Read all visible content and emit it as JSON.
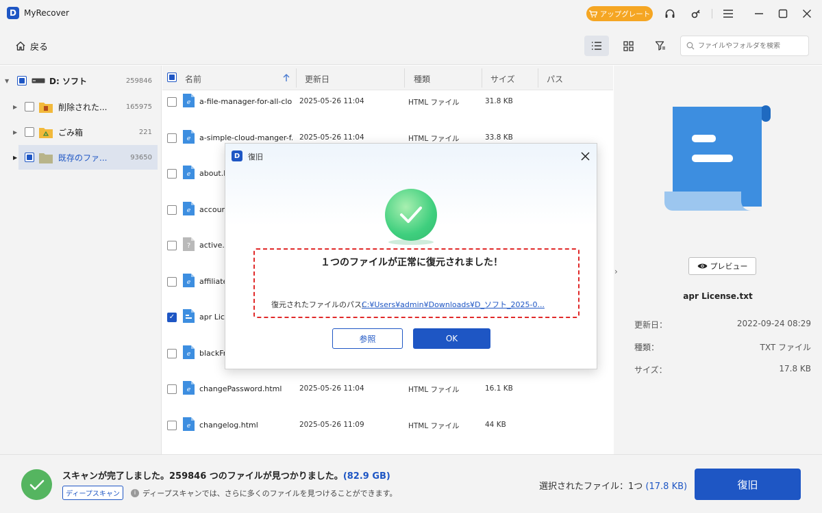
{
  "app": {
    "title": "MyRecover",
    "logo_letter": "D"
  },
  "titlebar": {
    "upgrade_label": "アップグレート"
  },
  "toolbar": {
    "back_label": "戻る",
    "search_placeholder": "ファイルやフォルダを検索"
  },
  "sidebar": {
    "items": [
      {
        "label": "D: ソフト",
        "count": "259846",
        "state": "partial"
      },
      {
        "label": "削除された...",
        "count": "165975",
        "state": "unchecked"
      },
      {
        "label": "ごみ箱",
        "count": "221",
        "state": "unchecked"
      },
      {
        "label": "既存のファ...",
        "count": "93650",
        "state": "partial",
        "selected": true
      }
    ]
  },
  "list": {
    "columns": [
      "名前",
      "更新日",
      "種類",
      "サイズ",
      "パス"
    ],
    "rows": [
      {
        "name": "a-file-manager-for-all-clo...",
        "date": "2025-05-26 11:04",
        "type": "HTML ファイル",
        "size": "31.8 KB",
        "icon": "html-file-icon"
      },
      {
        "name": "a-simple-cloud-manger-f...",
        "date": "2025-05-26 11:04",
        "type": "HTML ファイル",
        "size": "33.8 KB",
        "icon": "html-file-icon"
      },
      {
        "name": "about.h",
        "date": "",
        "type": "",
        "size": "",
        "icon": "html-file-icon"
      },
      {
        "name": "accoun",
        "date": "",
        "type": "",
        "size": "",
        "icon": "html-file-icon"
      },
      {
        "name": "active.h",
        "date": "",
        "type": "",
        "size": "",
        "icon": "unknown-file-icon"
      },
      {
        "name": "affiliate",
        "date": "",
        "type": "",
        "size": "",
        "icon": "html-file-icon"
      },
      {
        "name": "apr Lice",
        "date": "",
        "type": "",
        "size": "",
        "icon": "txt-file-icon",
        "checked": true
      },
      {
        "name": "blackFri",
        "date": "",
        "type": "",
        "size": "",
        "icon": "html-file-icon"
      },
      {
        "name": "changePassword.html",
        "date": "2025-05-26 11:04",
        "type": "HTML ファイル",
        "size": "16.1 KB",
        "icon": "html-file-icon"
      },
      {
        "name": "changelog.html",
        "date": "2025-05-26 11:09",
        "type": "HTML ファイル",
        "size": "44 KB",
        "icon": "html-file-icon"
      }
    ]
  },
  "preview": {
    "button_label": "プレビュー",
    "file_name": "apr License.txt",
    "fields": [
      {
        "key": "更新日：",
        "value": "2022-09-24 08:29"
      },
      {
        "key": "種類：",
        "value": "TXT ファイル"
      },
      {
        "key": "サイズ：",
        "value": "17.8 KB"
      }
    ]
  },
  "bottom": {
    "scan_message": "スキャンが完了しました。259846 つのファイルが見つかりました。",
    "scan_size": "(82.9 GB)",
    "deep_scan_label": "ディープスキャン",
    "deep_scan_info": "ディープスキャンでは、さらに多くのファイルを見つけることができます。",
    "selected_label": "選択されたファイル：1つ",
    "selected_size": "(17.8 KB)",
    "recover_label": "復旧"
  },
  "modal": {
    "title": "復旧",
    "message": "１つのファイルが正常に復元されました！",
    "path_label": "復元されたファイルのパス:",
    "path_value": "C:¥Users¥admin¥Downloads¥D_ソフト_2025-0...",
    "browse_label": "参照",
    "ok_label": "OK"
  },
  "colors": {
    "accent": "#1e56c4",
    "upgrade": "#f5a623",
    "success": "#3fcf7e",
    "highlight": "#e02828"
  }
}
